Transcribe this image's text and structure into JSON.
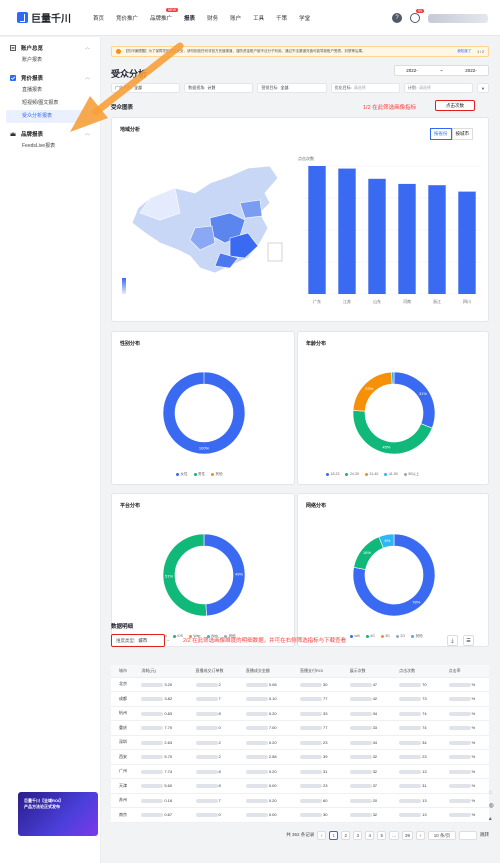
{
  "header": {
    "logo": "巨量千川",
    "nav": [
      "首页",
      "竞价推广",
      "品牌推广",
      "报表",
      "财务",
      "账户",
      "工具",
      "千策",
      "学堂"
    ],
    "hot_badge": "NEW",
    "help": "?",
    "notif_count": "99"
  },
  "sidebar": {
    "groups": [
      {
        "label": "账户总览",
        "items": [
          "账户报表"
        ]
      },
      {
        "label": "竞价报表",
        "items": [
          "直播报表",
          "短视频/图文报表",
          "受众分析报表"
        ]
      },
      {
        "label": "品牌报表",
        "items": [
          "FeedsLive报表"
        ]
      }
    ],
    "promo": {
      "line1": "巨量千川【全域ROI】",
      "line2": "产品方法论正式发布"
    }
  },
  "notice": {
    "text": "【防诈骗提醒】为了保障您的资金安全，请勿相信任何非官方充值渠道，谨防资金账户被不法分子利用。通过不法渠道充值可能导致账户受损，封禁等后果。",
    "link": "我知道了",
    "page": "1 / 2"
  },
  "page": {
    "title": "受众分析",
    "date_start": "2022-",
    "date_sep": "~",
    "date_end": "2022-"
  },
  "filters": [
    {
      "label": "广告平台:",
      "value": "全部"
    },
    {
      "label": "数据视角:",
      "value": "计划"
    },
    {
      "label": "营销目标:",
      "value": "全部"
    },
    {
      "label": "优化目标:",
      "placeholder": "请选择"
    },
    {
      "label": "计划:",
      "placeholder": "请选择"
    }
  ],
  "audience": {
    "section_title": "受众图表",
    "annot1": "1/2  在此筛选画像指标",
    "metric_button": "点击次数",
    "region": {
      "title": "地域分析",
      "toggle": [
        "按省份",
        "按城市"
      ],
      "metric_label": "点击次数"
    }
  },
  "chart_data": [
    {
      "type": "bar",
      "title": "地域分析",
      "categories": [
        "广东",
        "江苏",
        "山东",
        "河南",
        "浙江",
        "四川"
      ],
      "values": [
        100,
        98,
        90,
        86,
        85,
        80
      ],
      "ylabel": "点击次数"
    },
    {
      "type": "pie",
      "title": "性别分布",
      "labels": [
        "女性",
        "男性",
        "其他"
      ],
      "values": [
        100,
        0,
        0
      ],
      "colors": [
        "#3b6af2",
        "#10b87a",
        "#f79009"
      ]
    },
    {
      "type": "pie",
      "title": "年龄分布",
      "labels": [
        "18-23",
        "24-30",
        "31-40",
        "41-50",
        "50以上"
      ],
      "values": [
        31,
        45,
        23,
        1,
        0
      ],
      "colors": [
        "#3b6af2",
        "#10b87a",
        "#f79009",
        "#2db7f5",
        "#9aa5b8"
      ]
    },
    {
      "type": "pie",
      "title": "平台分布",
      "labels": [
        "Android",
        "iOS",
        "Wap",
        "Web",
        "其他"
      ],
      "values": [
        49,
        51,
        0,
        0,
        0
      ],
      "colors": [
        "#3b6af2",
        "#10b87a",
        "#f79009",
        "#2db7f5",
        "#9aa5b8"
      ]
    },
    {
      "type": "pie",
      "title": "网络分布",
      "labels": [
        "wifi",
        "4G",
        "3G",
        "2G",
        "其他"
      ],
      "values": [
        78,
        16,
        0,
        0,
        6
      ],
      "colors": [
        "#3b6af2",
        "#10b87a",
        "#f79009",
        "#9aa5b8",
        "#2db7f5"
      ]
    }
  ],
  "pie_labels": {
    "gender": [
      "100%"
    ],
    "age": [
      "31%",
      "45%",
      "23%"
    ],
    "platform": [
      "49%",
      "51%"
    ],
    "network": [
      "78%",
      "16%",
      "6%"
    ]
  },
  "detail": {
    "section_title": "数据明细",
    "dim_label": "维度类型:",
    "dim_value": "城市",
    "annot2": "2/2  在此筛选画像维度的明细数据，并可在右侧筛选指标与下载查看",
    "columns": [
      "城市",
      "消耗(元)",
      "直播成交订单数",
      "直播成交金额",
      "直播支付ROI",
      "展示次数",
      "点击次数",
      "点击率"
    ],
    "rows": [
      [
        "北京",
        "3.20",
        "2",
        "0.08",
        "30",
        "47",
        "70",
        "%"
      ],
      [
        "成都",
        "3.82",
        "7",
        "0.10",
        "77",
        "42",
        "73",
        "%"
      ],
      [
        "杭州",
        "0.83",
        "8",
        "0.20",
        "33",
        "34",
        "74",
        "%"
      ],
      [
        "重庆",
        "7.70",
        "0",
        "7.00",
        "77",
        "33",
        "74",
        "%"
      ],
      [
        "深圳",
        "2.63",
        "2",
        "0.20",
        "23",
        "34",
        "34",
        "%"
      ],
      [
        "西安",
        "5.70",
        "2",
        "2.58",
        "39",
        "32",
        "23",
        "%"
      ],
      [
        "广州",
        "7.74",
        "8",
        "0.20",
        "31",
        "32",
        "13",
        "%"
      ],
      [
        "天津",
        "5.60",
        "8",
        "0.00",
        "23",
        "37",
        "31",
        "%"
      ],
      [
        "苏州",
        "0.16",
        "7",
        "0.20",
        "60",
        "20",
        "13",
        "%"
      ],
      [
        "南京",
        "0.67",
        "0",
        "0.00",
        "30",
        "32",
        "13",
        "%"
      ]
    ]
  },
  "pager": {
    "total": "共 362 条记录",
    "pages": [
      "1",
      "2",
      "3",
      "4",
      "5",
      "...",
      "39"
    ],
    "size": "10 条/页",
    "jump": "跳转"
  }
}
